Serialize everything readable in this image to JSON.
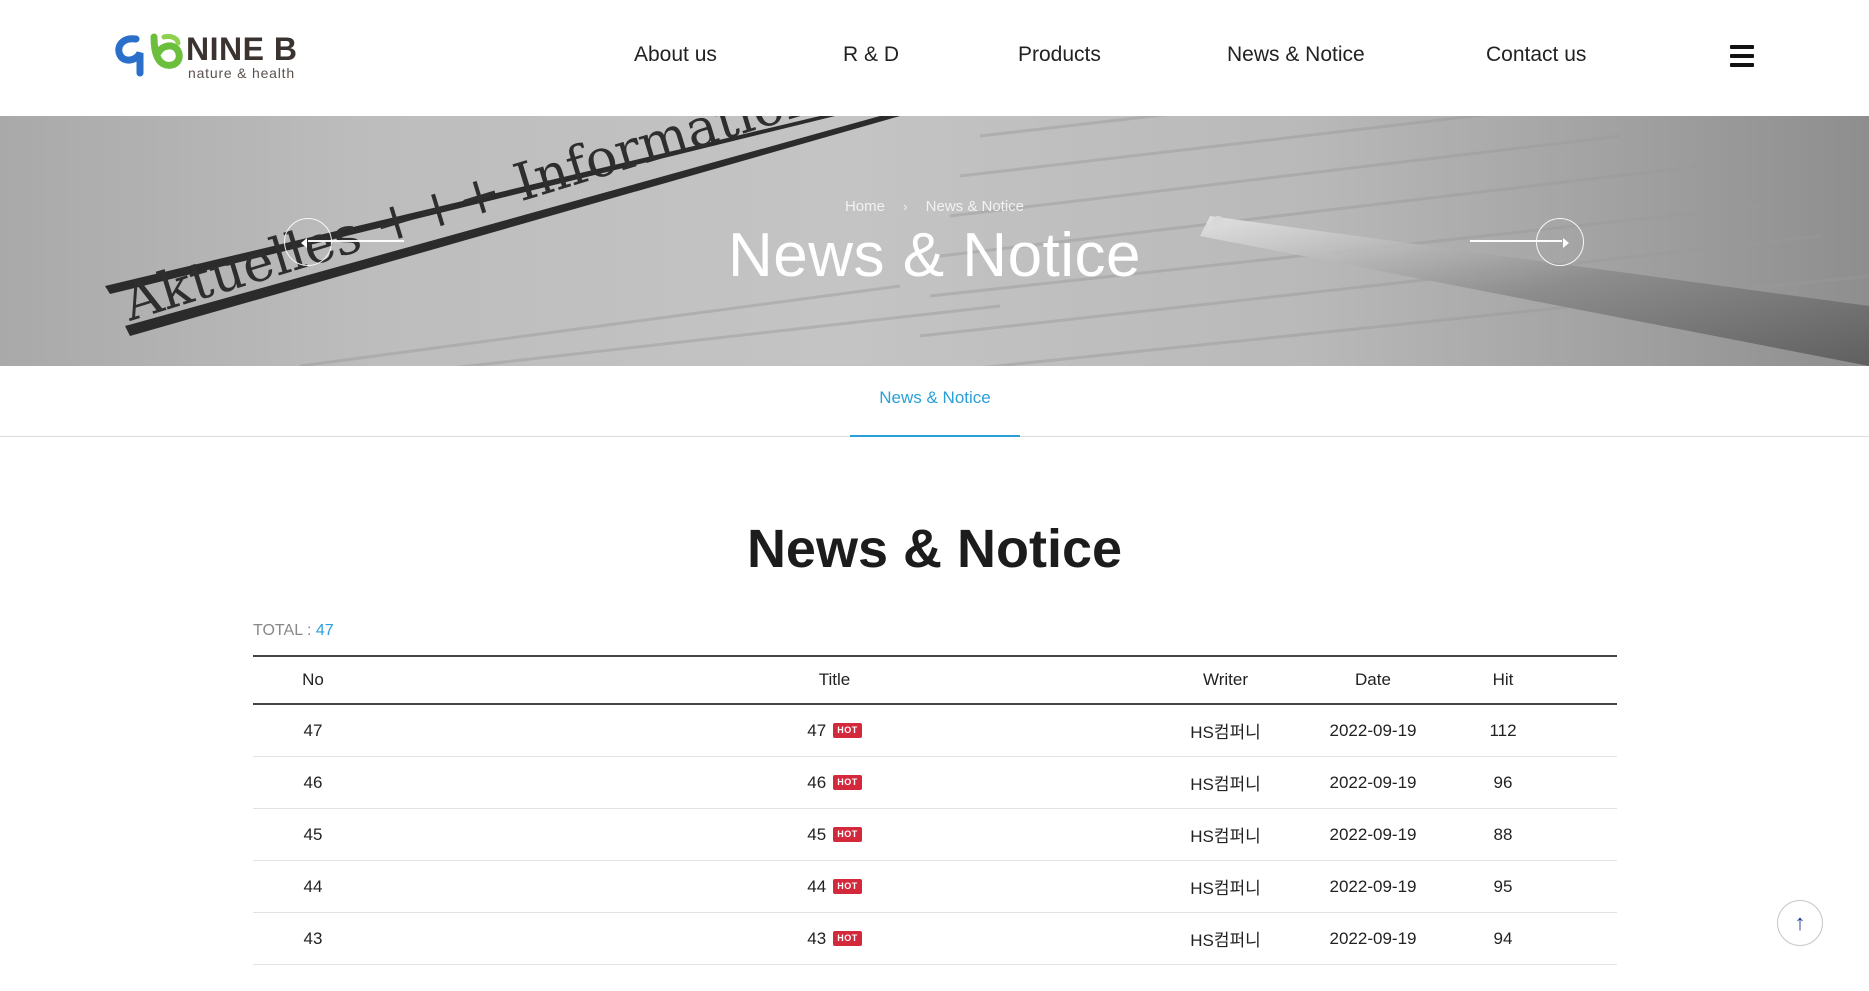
{
  "brand": {
    "name": "NINE B",
    "tagline": "nature & health",
    "colors": {
      "green": "#6cbf3c",
      "blue": "#2a6fc9",
      "dark": "#3a3330"
    }
  },
  "nav": {
    "items": [
      "About us",
      "R & D",
      "Products",
      "News & Notice",
      "Contact us"
    ],
    "menu_icon": "hamburger-icon"
  },
  "banner": {
    "breadcrumb": {
      "home": "Home",
      "current": "News & Notice"
    },
    "title": "News & Notice"
  },
  "subtab": {
    "active_label": "News & Notice"
  },
  "board": {
    "title": "News & Notice",
    "total_label": "TOTAL : ",
    "total_value": "47",
    "headers": {
      "no": "No",
      "title": "Title",
      "writer": "Writer",
      "date": "Date",
      "hit": "Hit"
    },
    "hot_label": "HOT",
    "rows": [
      {
        "no": "47",
        "title": "47",
        "writer": "HS컴퍼니",
        "date": "2022-09-19",
        "hit": "112"
      },
      {
        "no": "46",
        "title": "46",
        "writer": "HS컴퍼니",
        "date": "2022-09-19",
        "hit": "96"
      },
      {
        "no": "45",
        "title": "45",
        "writer": "HS컴퍼니",
        "date": "2022-09-19",
        "hit": "88"
      },
      {
        "no": "44",
        "title": "44",
        "writer": "HS컴퍼니",
        "date": "2022-09-19",
        "hit": "95"
      },
      {
        "no": "43",
        "title": "43",
        "writer": "HS컴퍼니",
        "date": "2022-09-19",
        "hit": "94"
      }
    ]
  },
  "accent_color": "#2a9fd8",
  "hot_color": "#d4283c",
  "scroll_top_icon": "arrow-up-icon"
}
